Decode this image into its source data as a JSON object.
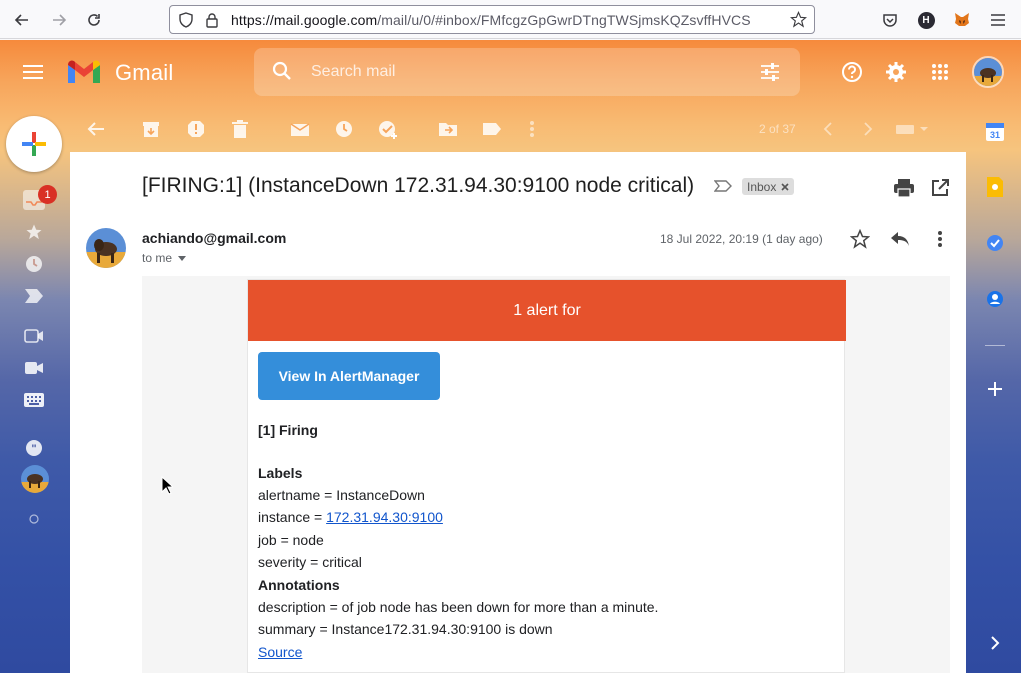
{
  "browser": {
    "url_host": "https://mail.google.com",
    "url_path": "/mail/u/0/#inbox/FMfcgzGpGwrDTngTWSjmsKQZsvffHVCS",
    "profile_initial": "H"
  },
  "gmail": {
    "app_name": "Gmail",
    "search_placeholder": "Search mail",
    "unread_count": "1",
    "pager_text": "2 of 37"
  },
  "email": {
    "subject": "[FIRING:1] (InstanceDown 172.31.94.30:9100 node critical)",
    "label_chip": "Inbox",
    "sender": "achiando@gmail.com",
    "recipient": "to me",
    "date": "18 Jul 2022, 20:19 (1 day ago)"
  },
  "alert": {
    "header": "1 alert for",
    "button_label": "View In AlertManager",
    "firing_title": "[1] Firing",
    "labels_title": "Labels",
    "alertname": "alertname = InstanceDown",
    "instance_prefix": "instance = ",
    "instance_link": "172.31.94.30:9100",
    "job": "job = node",
    "severity": "severity = critical",
    "annotations_title": "Annotations",
    "description": "description = of job node has been down for more than a minute.",
    "summary": "summary = Instance172.31.94.30:9100 is down",
    "source_link": "Source"
  },
  "colors": {
    "alert_header": "#e6522c",
    "button": "#348eda",
    "link": "#1155cc",
    "badge": "#d93025"
  }
}
